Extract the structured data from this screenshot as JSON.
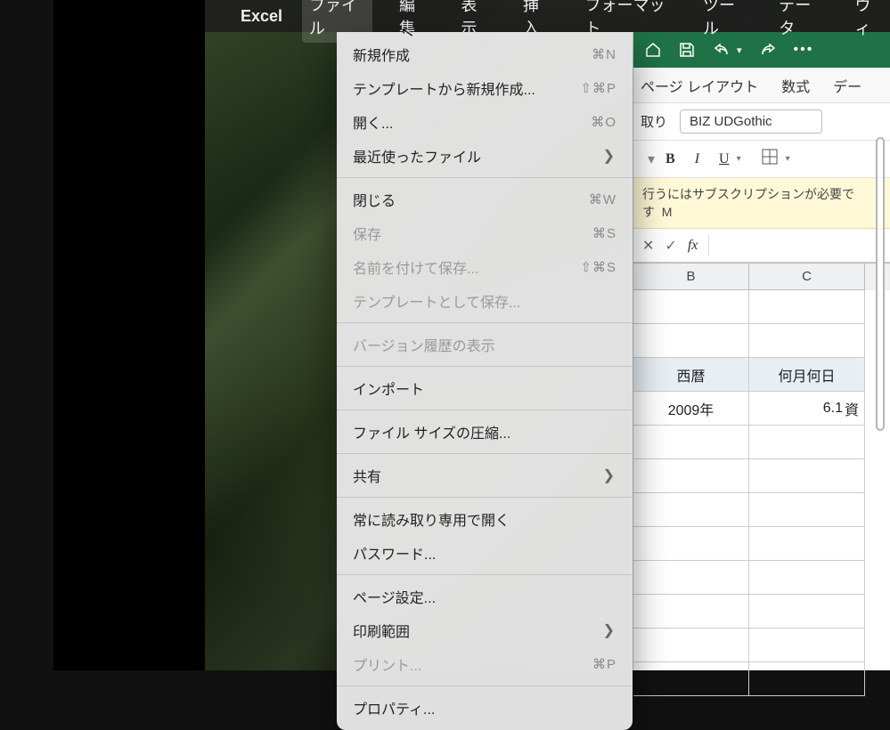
{
  "menubar": {
    "app_name": "Excel",
    "items": [
      "ファイル",
      "編集",
      "表示",
      "挿入",
      "フォーマット",
      "ツール",
      "データ",
      "ウィ"
    ]
  },
  "file_menu": {
    "sections": [
      [
        {
          "label": "新規作成",
          "shortcut": "⌘N",
          "disabled": false
        },
        {
          "label": "テンプレートから新規作成...",
          "shortcut": "⇧⌘P",
          "disabled": false
        },
        {
          "label": "開く...",
          "shortcut": "⌘O",
          "disabled": false
        },
        {
          "label": "最近使ったファイル",
          "submenu": true,
          "disabled": false
        }
      ],
      [
        {
          "label": "閉じる",
          "shortcut": "⌘W",
          "disabled": false
        },
        {
          "label": "保存",
          "shortcut": "⌘S",
          "disabled": true
        },
        {
          "label": "名前を付けて保存...",
          "shortcut": "⇧⌘S",
          "disabled": true
        },
        {
          "label": "テンプレートとして保存...",
          "disabled": true
        }
      ],
      [
        {
          "label": "バージョン履歴の表示",
          "disabled": true
        }
      ],
      [
        {
          "label": "インポート",
          "disabled": false
        }
      ],
      [
        {
          "label": "ファイル サイズの圧縮...",
          "disabled": false
        }
      ],
      [
        {
          "label": "共有",
          "submenu": true,
          "disabled": false
        }
      ],
      [
        {
          "label": "常に読み取り専用で開く",
          "disabled": false
        },
        {
          "label": "パスワード...",
          "disabled": false
        }
      ],
      [
        {
          "label": "ページ設定...",
          "disabled": false
        },
        {
          "label": "印刷範囲",
          "submenu": true,
          "disabled": false
        },
        {
          "label": "プリント...",
          "shortcut": "⌘P",
          "disabled": true
        }
      ],
      [
        {
          "label": "プロパティ...",
          "disabled": false
        }
      ]
    ]
  },
  "excel": {
    "ribbon_tabs": [
      "ページ レイアウト",
      "数式",
      "デー"
    ],
    "toolbar_label_paste_f": "取り",
    "font_name": "BIZ UDGothic",
    "format": {
      "b": "B",
      "i": "I",
      "u": "U"
    },
    "banner": "行うにはサブスクリプションが必要です",
    "banner_right": "M",
    "formula_bar": {
      "fx": "fx"
    },
    "columns": [
      "B",
      "C"
    ],
    "header_row": [
      "西暦",
      "何月何日"
    ],
    "data_row": [
      "2009年",
      "6.1"
    ],
    "data_right_extra": "資"
  }
}
